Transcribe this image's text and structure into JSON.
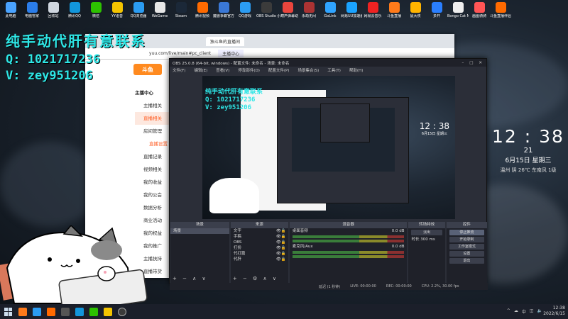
{
  "desktop_icons": [
    {
      "label": "此电脑",
      "color": "#4aa3ff"
    },
    {
      "label": "电脑管家",
      "color": "#2b7de9"
    },
    {
      "label": "回收站",
      "color": "#cfd6df"
    },
    {
      "label": "腾讯QQ",
      "color": "#1296db"
    },
    {
      "label": "微信",
      "color": "#2dc100"
    },
    {
      "label": "YY语音",
      "color": "#f4c400"
    },
    {
      "label": "QQ浏览器",
      "color": "#2b9cf2"
    },
    {
      "label": "WeGame",
      "color": "#e7e7e7"
    },
    {
      "label": "Steam",
      "color": "#1b2838"
    },
    {
      "label": "腾讯视频",
      "color": "#ff6a00"
    },
    {
      "label": "魔兽争霸官方对战平台",
      "color": "#3a78d6"
    },
    {
      "label": "QQ游戏",
      "color": "#2b9cf2"
    },
    {
      "label": "OBS Studio",
      "color": "#3b3b3b"
    },
    {
      "label": "小葫芦弹幕助手",
      "color": "#e9453d"
    },
    {
      "label": "永劫无间",
      "color": "#a33"
    },
    {
      "label": "GoLink",
      "color": "#2fa4ff"
    },
    {
      "label": "网易UU加速器",
      "color": "#1aa3ff"
    },
    {
      "label": "网易云音乐",
      "color": "#e22"
    },
    {
      "label": "斗鱼直播",
      "color": "#ff7a1a"
    },
    {
      "label": "鼠大侠",
      "color": "#ffb400"
    },
    {
      "label": "多开",
      "color": "#2a7fff"
    },
    {
      "label": "Bongo Cat Mver",
      "color": "#eee"
    },
    {
      "label": "画图骑骑",
      "color": "#f55"
    },
    {
      "label": "斗鱼直播伴侣",
      "color": "#ff6a00"
    }
  ],
  "overlay": {
    "line1": "纯手动代肝有意联系",
    "line2": "Q: 1021717236",
    "line3": "V: zey951206"
  },
  "browser": {
    "tab1": "独斗鱼的直播间",
    "tab2": "主播中心",
    "url": "yuu.com/live/main#pc_client",
    "logo": "斗鱼",
    "menu": [
      {
        "label": "主播中心",
        "type": "head"
      },
      {
        "label": "主播相关",
        "type": "item"
      },
      {
        "label": "直播相关",
        "type": "active"
      },
      {
        "label": "房间管理",
        "type": "item"
      },
      {
        "label": "直播设置",
        "type": "sub"
      },
      {
        "label": "直播记录",
        "type": "item"
      },
      {
        "label": "视频相关",
        "type": "item"
      },
      {
        "label": "我的收益",
        "type": "item"
      },
      {
        "label": "我的公会",
        "type": "item"
      },
      {
        "label": "数据分析",
        "type": "item"
      },
      {
        "label": "商业活动",
        "type": "item"
      },
      {
        "label": "我的权益",
        "type": "item"
      },
      {
        "label": "我的推广",
        "type": "item"
      },
      {
        "label": "主播扶持",
        "type": "item"
      },
      {
        "label": "直播带货",
        "type": "item"
      }
    ]
  },
  "obs": {
    "title": "OBS 25.0.8 (64-bit, windows) - 配置文件: 未命名 - 场景: 未命名",
    "menus": [
      "文件(F)",
      "编辑(E)",
      "查看(V)",
      "停靠部件(D)",
      "配置文件(P)",
      "场景集合(S)",
      "工具(T)",
      "帮助(H)"
    ],
    "docks": {
      "scenes_title": "场景",
      "scenes": [
        "场景"
      ],
      "sources_title": "来源",
      "sources": [
        "文字",
        "手稿",
        "OBS",
        "打扮",
        "代打篇",
        "代肝"
      ],
      "mixer_title": "混音器",
      "mixer_tracks": [
        {
          "name": "桌面音频",
          "value": "0.0 dB"
        },
        {
          "name": "麦克风/Aux",
          "value": "0.0 dB"
        }
      ],
      "transitions_title": "转场特效",
      "transition_type": "淡出",
      "duration_label": "时长",
      "duration_value": "300 ms",
      "controls_title": "控件",
      "controls": [
        "停止推流",
        "开始录制",
        "工作室模式",
        "设置",
        "退出"
      ]
    },
    "status": {
      "live": "LIVE: 00:00:00",
      "rec": "REC: 00:00:00",
      "cpu": "CPU: 2.2%, 30.00 fps",
      "extra": "延迟 (1 秒钟)"
    }
  },
  "clock": {
    "time": "12 : 38",
    "seconds": "21",
    "date": "6月15日 星期三",
    "weather": "温州 阴 26℃ 东南风 1级"
  },
  "taskbar": {
    "tray_icons": [
      "^",
      "☁",
      "中",
      "◫",
      "🔈"
    ],
    "time": "12:38",
    "date": "2022/6/15"
  }
}
